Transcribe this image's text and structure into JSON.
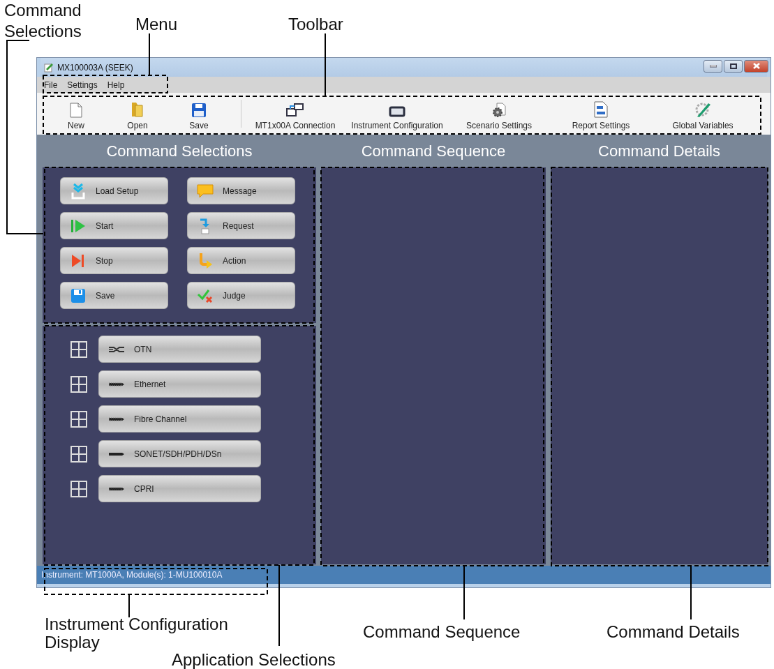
{
  "window": {
    "title": "MX100003A (SEEK)"
  },
  "menu": [
    "File",
    "Settings",
    "Help"
  ],
  "toolbar": [
    {
      "label": "New"
    },
    {
      "label": "Open"
    },
    {
      "label": "Save"
    },
    {
      "label": "MT1x00A Connection"
    },
    {
      "label": "Instrument Configuration"
    },
    {
      "label": "Scenario Settings"
    },
    {
      "label": "Report Settings"
    },
    {
      "label": "Global Variables"
    }
  ],
  "panels": [
    "Command Selections",
    "Command Sequence",
    "Command Details"
  ],
  "command_buttons": [
    {
      "label": "Load Setup"
    },
    {
      "label": "Message"
    },
    {
      "label": "Start"
    },
    {
      "label": "Request"
    },
    {
      "label": "Stop"
    },
    {
      "label": "Action"
    },
    {
      "label": "Save"
    },
    {
      "label": "Judge"
    }
  ],
  "applications": [
    {
      "label": "OTN",
      "expanded": false
    },
    {
      "label": "Ethernet",
      "expanded": false
    },
    {
      "label": "Fibre Channel",
      "expanded": false
    },
    {
      "label": "SONET/SDH/PDH/DSn",
      "expanded": false
    },
    {
      "label": "CPRI",
      "expanded": false
    }
  ],
  "status_bar": "Instrument: MT1000A, Module(s): 1-MU100010A",
  "annotations": [
    {
      "label": "Command Selections"
    },
    {
      "label": "Menu"
    },
    {
      "label": "Toolbar"
    },
    {
      "label": "Instrument Configuration Display"
    },
    {
      "label": "Command Sequence"
    },
    {
      "label": "Command Details"
    },
    {
      "label": "Application Selections"
    }
  ]
}
